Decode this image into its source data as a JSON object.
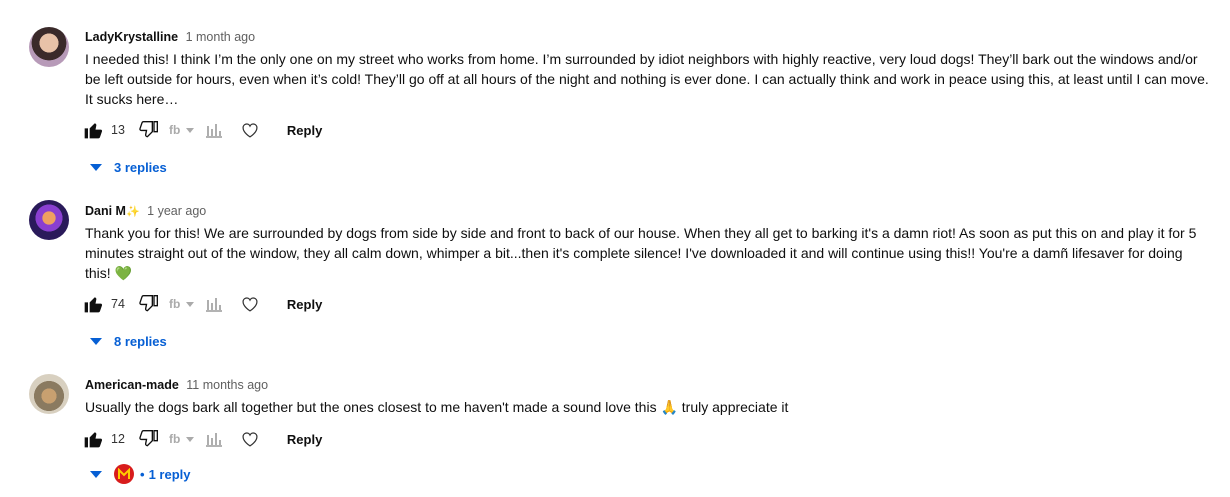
{
  "comments": [
    {
      "author": "LadyKrystalline",
      "time": "1 month ago",
      "text": "I needed this! I think I’m the only one on my street who works from home. I’m surrounded by idiot neighbors with highly reactive, very loud dogs! They’ll bark out the windows and/or be left outside for hours, even when it’s cold! They’ll go off at all hours of the night and nothing is ever done. I can actually think and work in peace using this, at least until I can move. It sucks here…",
      "likes": "13",
      "reply_label": "Reply",
      "replies_label": "3 replies"
    },
    {
      "author": "Dani M",
      "author_emoji": "✨",
      "time": "1 year ago",
      "text": "Thank you for this!  We are surrounded by dogs from side by side and front to back of our house.  When they all get to barking it's a damn riot!  As soon as put this on and play it for 5 minutes straight out of the window, they all calm down, whimper a bit...then it's complete silence!  I've downloaded it and will continue using this!! You're a damñ lifesaver for doing this! 💚",
      "likes": "74",
      "reply_label": "Reply",
      "replies_label": "8 replies"
    },
    {
      "author": "American-made",
      "time": "11 months ago",
      "text": "Usually the dogs bark all together but the ones closest to me haven't made a sound love this 🙏 truly appreciate it",
      "likes": "12",
      "reply_label": "Reply",
      "replies_label": "1 reply"
    }
  ],
  "icons": {
    "like": "thumbs-up-icon",
    "dislike": "thumbs-down-icon",
    "translate": "translate-icon",
    "stats": "bar-chart-icon",
    "heart": "heart-icon",
    "expand": "chevron-down-icon"
  },
  "colors": {
    "link": "#065fd4",
    "text": "#0f0f0f",
    "secondary": "#606060"
  }
}
